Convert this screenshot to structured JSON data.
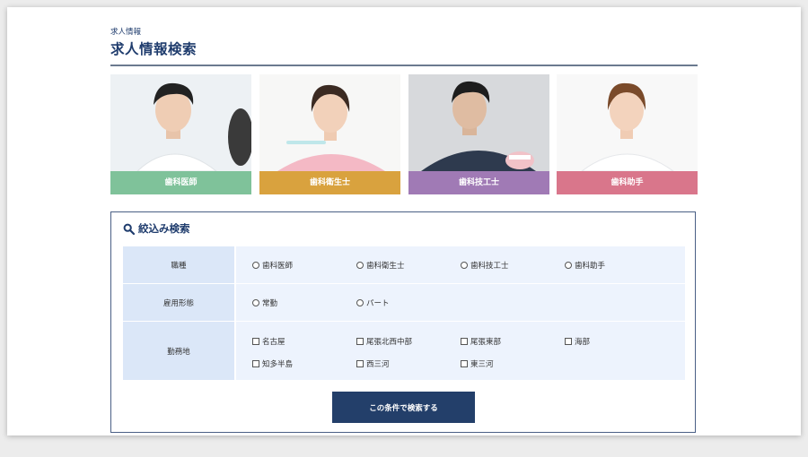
{
  "header": {
    "small": "求人情報",
    "title": "求人情報検索"
  },
  "categories": [
    {
      "label": "歯科医師",
      "color": "#7fc29a"
    },
    {
      "label": "歯科衛生士",
      "color": "#d9a23e"
    },
    {
      "label": "歯科技工士",
      "color": "#a07ab5"
    },
    {
      "label": "歯科助手",
      "color": "#d9768b"
    }
  ],
  "search": {
    "title": "絞込み検索",
    "rows": [
      {
        "label": "職種",
        "options": [
          "歯科医師",
          "歯科衛生士",
          "歯科技工士",
          "歯科助手"
        ]
      },
      {
        "label": "雇用形態",
        "options": [
          "常勤",
          "パート"
        ]
      },
      {
        "label": "勤務地",
        "options": [
          "名古屋",
          "尾張北西中部",
          "尾張東部",
          "海部",
          "知多半島",
          "西三河",
          "東三河"
        ]
      }
    ],
    "submit_label": "この条件で検索する"
  },
  "colors": {
    "brand": "#1f3c6d",
    "button": "#233f6a",
    "label_bg": "#dbe7f8",
    "options_bg": "#edf3fd"
  }
}
